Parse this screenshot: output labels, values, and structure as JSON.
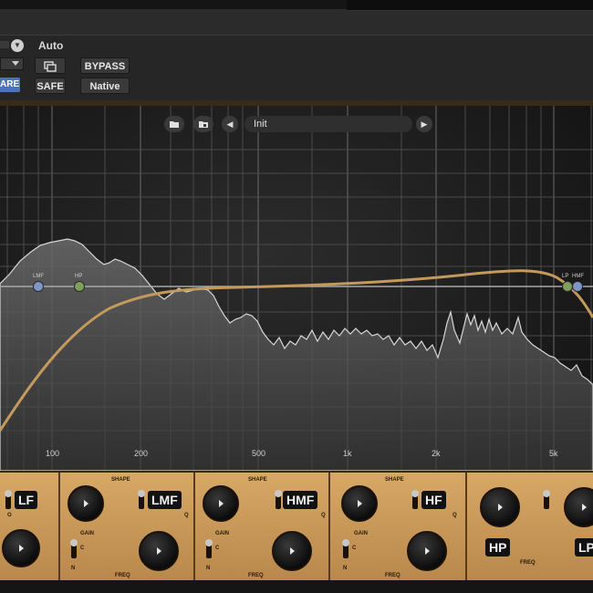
{
  "host": {
    "auto_label": "Auto",
    "bypass_label": "BYPASS",
    "safe_label": "SAFE",
    "native_label": "Native",
    "compare_label": "ARE"
  },
  "preset": {
    "name": "Init"
  },
  "eq": {
    "freq_ticks": [
      "100",
      "200",
      "500",
      "1k",
      "2k",
      "5k"
    ],
    "node_labels": [
      "LMF",
      "HP",
      "LP",
      "HMF"
    ],
    "curve_color": "#c49a5c",
    "flat_line_color": "#a8a8a8",
    "node_color_lmf": "#7f97c8",
    "node_color_hp": "#7ea05a"
  },
  "strip": {
    "bands": [
      "LF",
      "LMF",
      "HMF",
      "HF",
      "HP",
      "LP"
    ],
    "shape_label": "SHAPE",
    "gain_label": "GAIN",
    "freq_label": "FREQ",
    "q_label": "Q",
    "c_label": "C",
    "n_label": "N",
    "o_label": "O"
  }
}
